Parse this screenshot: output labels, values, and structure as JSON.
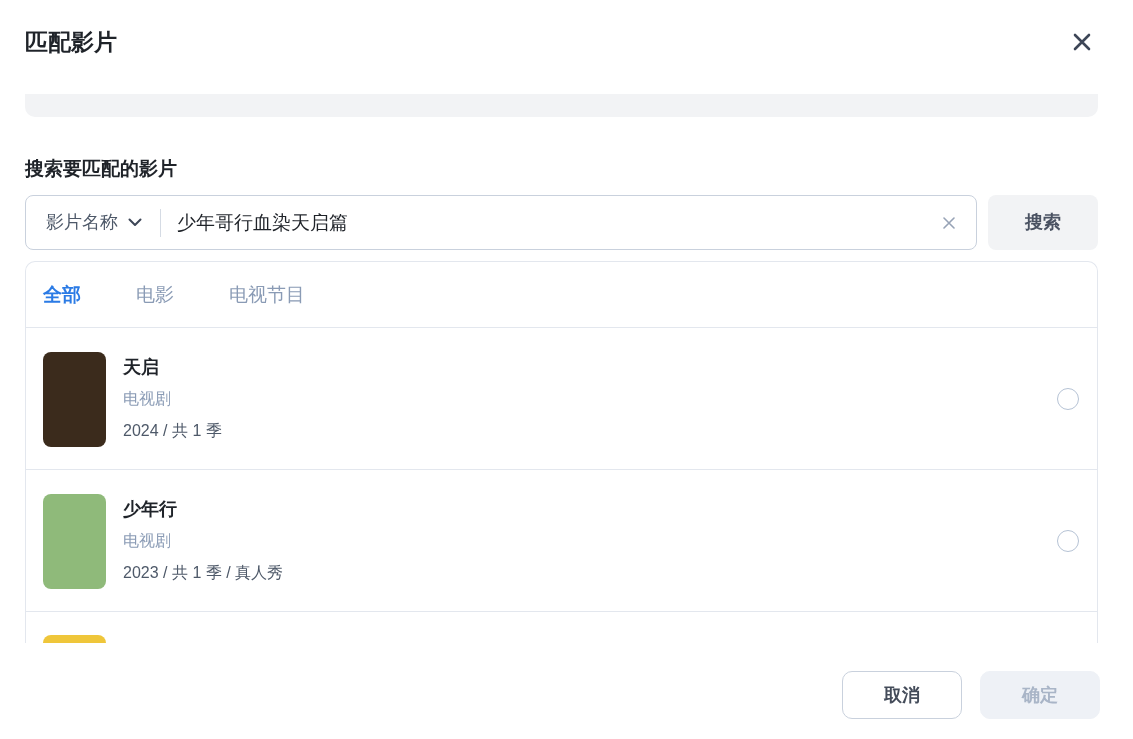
{
  "dialog": {
    "title": "匹配影片"
  },
  "search": {
    "label": "搜索要匹配的影片",
    "field_type": "影片名称",
    "value": "少年哥行血染天启篇",
    "button": "搜索"
  },
  "tabs": [
    {
      "label": "全部",
      "selected": true
    },
    {
      "label": "电影",
      "selected": false
    },
    {
      "label": "电视节目",
      "selected": false
    }
  ],
  "results": [
    {
      "kind": "full",
      "title": "天启",
      "type": "电视剧",
      "meta": "2024 / 共 1 季",
      "selected": false
    },
    {
      "kind": "full",
      "title": "少年行",
      "type": "电视剧",
      "meta": "2023 / 共 1 季 / 真人秀",
      "selected": false
    },
    {
      "kind": "cut"
    }
  ],
  "buttons": [
    {
      "label": "取消",
      "disabled": false
    },
    {
      "label": "确定",
      "disabled": true
    }
  ]
}
